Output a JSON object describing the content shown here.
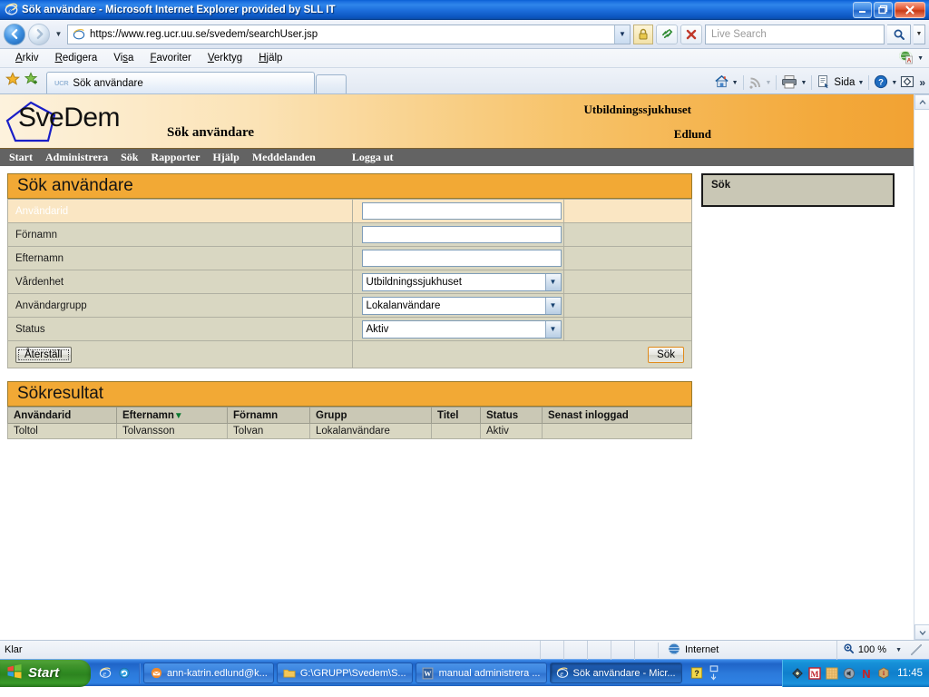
{
  "window": {
    "title": "Sök användare - Microsoft Internet Explorer provided by SLL IT",
    "minimize_label": "–",
    "maximize_label": "❐",
    "close_label": "✕"
  },
  "navbar": {
    "back_label": "◄",
    "forward_label": "►",
    "history_caret": "▼",
    "url": "https://www.reg.ucr.uu.se/svedem/searchUser.jsp",
    "url_dropdown_caret": "▼",
    "refresh_label": "↻",
    "stop_label": "✕",
    "search_placeholder": "Live Search",
    "search_go_label": "🔍",
    "search_go_caret": "▼"
  },
  "menubar": {
    "items": [
      "Arkiv",
      "Redigera",
      "Visa",
      "Favoriter",
      "Verktyg",
      "Hjälp"
    ],
    "right_caret": "▼"
  },
  "tabbar": {
    "tab_favicon": "UCR",
    "tab_label": "Sök användare",
    "tools": {
      "home_caret": "▼",
      "feeds_caret": "▼",
      "print_caret": "▼",
      "page_label": "Sida",
      "page_caret": "▼",
      "help_caret": "▼",
      "overflow": "»"
    }
  },
  "site": {
    "logo_text": "SveDem",
    "page_subtitle": "Sök användare",
    "unit": "Utbildningssjukhuset",
    "user": "Edlund",
    "nav": [
      {
        "label": "Start"
      },
      {
        "label": "Administrera"
      },
      {
        "label": "Sök"
      },
      {
        "label": "Rapporter"
      },
      {
        "label": "Hjälp"
      },
      {
        "label": "Meddelanden"
      },
      {
        "label": "Logga ut"
      }
    ]
  },
  "search_form": {
    "title": "Sök användare",
    "fields": [
      {
        "label": "Användarid",
        "type": "text",
        "value": "",
        "highlight": true
      },
      {
        "label": "Förnamn",
        "type": "text",
        "value": "",
        "highlight": false
      },
      {
        "label": "Efternamn",
        "type": "text",
        "value": "",
        "highlight": false
      },
      {
        "label": "Vårdenhet",
        "type": "select",
        "value": "Utbildningssjukhuset",
        "highlight": false
      },
      {
        "label": "Användargrupp",
        "type": "select",
        "value": "Lokalanvändare",
        "highlight": false
      },
      {
        "label": "Status",
        "type": "select",
        "value": "Aktiv",
        "highlight": false
      }
    ],
    "reset_label": "Återställ",
    "submit_label": "Sök"
  },
  "results": {
    "title": "Sökresultat",
    "columns": [
      "Användarid",
      "Efternamn",
      "Förnamn",
      "Grupp",
      "Titel",
      "Status",
      "Senast inloggad"
    ],
    "sorted_column": "Efternamn",
    "sort_arrow": "▼",
    "rows": [
      {
        "Användarid": "Toltol",
        "Efternamn": "Tolvansson",
        "Förnamn": "Tolvan",
        "Grupp": "Lokalanvändare",
        "Titel": "",
        "Status": "Aktiv",
        "Senast inloggad": ""
      }
    ]
  },
  "sidebar": {
    "box_title": "Sök"
  },
  "page_scrollbar": {
    "up_label": "▲",
    "down_label": "▼"
  },
  "statusbar": {
    "status": "Klar",
    "zone": "Internet",
    "zoom": "100 %",
    "zoom_caret": "▼"
  },
  "taskbar": {
    "start_label": "Start",
    "items": [
      {
        "label": "ann-katrin.edlund@k...",
        "active": false
      },
      {
        "label": "G:\\GRUPP\\Svedem\\S...",
        "active": false
      },
      {
        "label": "manual administrera ...",
        "active": false
      },
      {
        "label": "Sök användare - Micr...",
        "active": true
      }
    ],
    "clock": "11:45"
  },
  "colors": {
    "accent_orange": "#f2a935",
    "header_gradient_start": "#fdf2dd",
    "header_gradient_end": "#f2a233",
    "nav_bar": "#636363",
    "table_row": "#d9d7c2",
    "table_header": "#cac8b5",
    "highlight_row": "#fae6c3",
    "sort_arrow_green": "#0a7a30",
    "sidebar_box": "#c9c7b5"
  }
}
